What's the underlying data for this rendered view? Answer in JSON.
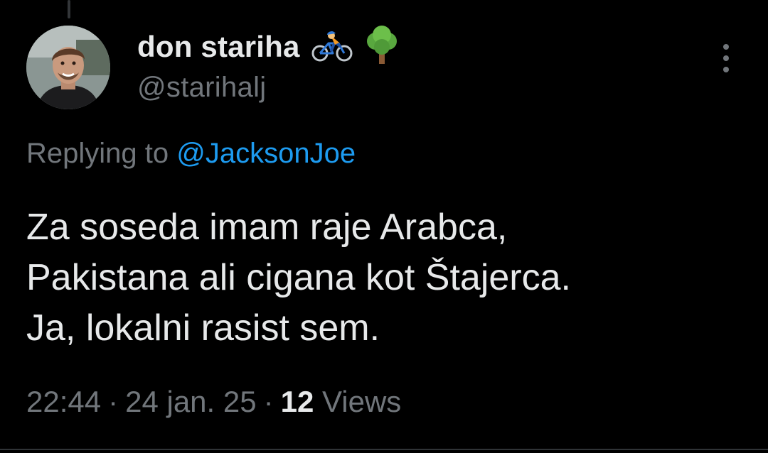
{
  "colors": {
    "background": "#000000",
    "text_primary": "#e7e9ea",
    "text_secondary": "#71767b",
    "link": "#1d9bf0",
    "divider": "#2f3336"
  },
  "author": {
    "display_name": "don stariha",
    "handle": "@starihalj",
    "name_emojis": [
      "person-biking-icon",
      "deciduous-tree-icon"
    ],
    "avatar_icon": "profile-photo-avatar"
  },
  "more_options_icon": "more-vertical-icon",
  "reply_context": {
    "prefix": "Replying to",
    "mention": "@JacksonJoe"
  },
  "tweet": {
    "lines": [
      "Za soseda imam raje Arabca,",
      "Pakistana ali cigana kot Štajerca.",
      "Ja, lokalni rasist sem."
    ]
  },
  "meta": {
    "time": "22:44",
    "separator": "·",
    "date": "24 jan. 25",
    "views_count": "12",
    "views_label": "Views"
  }
}
